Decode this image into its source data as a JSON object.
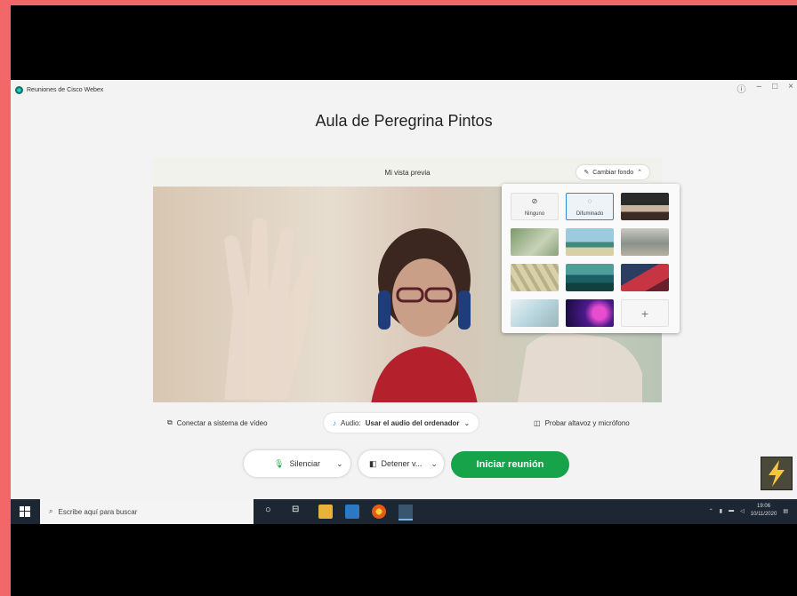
{
  "app": {
    "window_title": "Reuniones de Cisco Webex",
    "meeting_title": "Aula de Peregrina Pintos"
  },
  "preview": {
    "header_label": "Mi vista previa",
    "change_background_label": "Cambiar fondo"
  },
  "background_picker": {
    "options": [
      {
        "label": "Ninguno",
        "icon": "none-icon"
      },
      {
        "label": "Difuminado",
        "icon": "blur-icon"
      }
    ],
    "add_label": "+"
  },
  "options_bar": {
    "connect_video_label": "Conectar a sistema de vídeo",
    "audio_prefix": "Audio:",
    "audio_value": "Usar el audio del ordenador",
    "test_audio_label": "Probar altavoz y micrófono"
  },
  "controls": {
    "mute_label": "Silenciar",
    "stop_video_label": "Detener v...",
    "start_meeting_label": "Iniciar reunión"
  },
  "taskbar": {
    "search_placeholder": "Escribe aquí para buscar",
    "time": "19:06",
    "date": "10/11/2020"
  },
  "colors": {
    "frame_accent": "#f26767",
    "start_button": "#16a34a",
    "taskbar": "#1d2633"
  }
}
